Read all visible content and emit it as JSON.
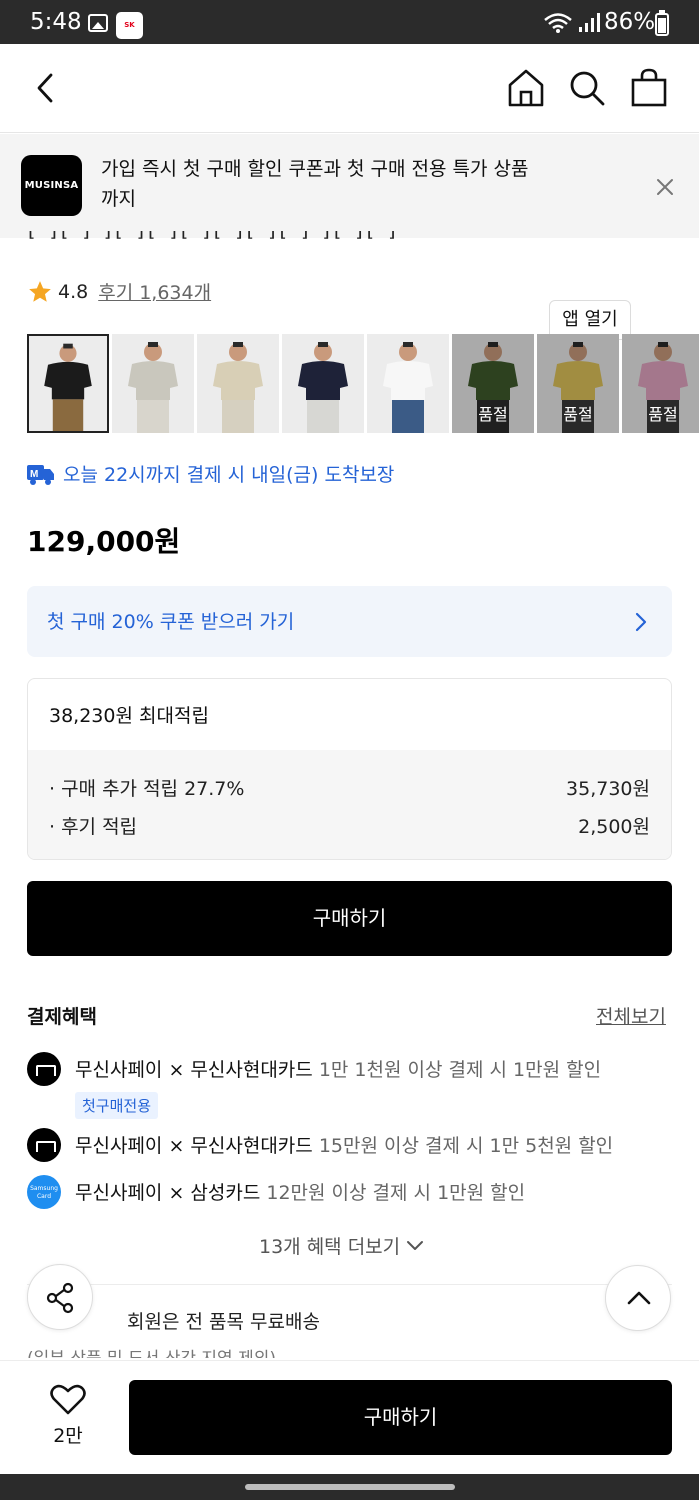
{
  "status_bar": {
    "time": "5:48",
    "sk_label": "SK store",
    "battery": "86%"
  },
  "header": {
    "icons": [
      "back-icon",
      "home-icon",
      "search-icon",
      "shopping-bag-icon"
    ]
  },
  "app_banner": {
    "logo_text": "MUSINSA",
    "message": "가입 즉시 첫 구매 할인 쿠폰과 첫 구매 전용 특가 상품까지",
    "open_label": "앱 열기"
  },
  "product": {
    "rating": "4.8",
    "reviews": "후기 1,634개",
    "delivery": "오늘 22시까지 결제 시 내일(금) 도착보장",
    "price": "129,000원"
  },
  "thumbnails": [
    {
      "shirt": "#1b1b1b",
      "pants": "#8a6a3f",
      "sold_out": ""
    },
    {
      "shirt": "#c9c7bd",
      "pants": "#d8d5cc",
      "sold_out": ""
    },
    {
      "shirt": "#d8cfb6",
      "pants": "#d6d0c0",
      "sold_out": ""
    },
    {
      "shirt": "#1e2238",
      "pants": "#d7d7d3",
      "sold_out": ""
    },
    {
      "shirt": "#f7f7f7",
      "pants": "#3b5b86",
      "sold_out": ""
    },
    {
      "shirt": "#3f5a2c",
      "pants": "#2c2c2c",
      "sold_out": "품절"
    },
    {
      "shirt": "#e0c45a",
      "pants": "#3a3a3a",
      "sold_out": "품절"
    },
    {
      "shirt": "#e3a6c2",
      "pants": "#3a3a3a",
      "sold_out": "품절"
    }
  ],
  "coupon": {
    "label": "첫 구매 20% 쿠폰 받으러 가기"
  },
  "points": {
    "max": "38,230원 최대적립",
    "rows": [
      {
        "label": "· 구매 추가 적립 27.7%",
        "amount": "35,730원"
      },
      {
        "label": "· 후기 적립",
        "amount": "2,500원"
      }
    ]
  },
  "buy_label": "구매하기",
  "benefits": {
    "title": "결제혜택",
    "view_all": "전체보기",
    "items": [
      {
        "name": "무신사페이 × 무신사현대카드",
        "condition": "1만 1천원 이상 결제 시 1만원 할인",
        "tag": "첫구매전용"
      },
      {
        "name": "무신사페이 × 무신사현대카드",
        "condition": "15만원 이상 결제 시 1만 5천원 할인"
      },
      {
        "name": "무신사페이 × 삼성카드",
        "condition": "12만원 이상 결제 시 1만원 할인",
        "card_label": "Samsung Card"
      }
    ],
    "more": "13개 혜택 더보기"
  },
  "shipping": {
    "text": "회원은 전 품목 무료배송",
    "sub": "(일부 상품 및 도서 산간 지역 제외)"
  },
  "bottom_bar": {
    "likes": "2만",
    "buy_label": "구매하기"
  },
  "colors": {
    "accent_blue": "#2563d6",
    "black": "#000000",
    "rating_star": "#f5a623"
  }
}
